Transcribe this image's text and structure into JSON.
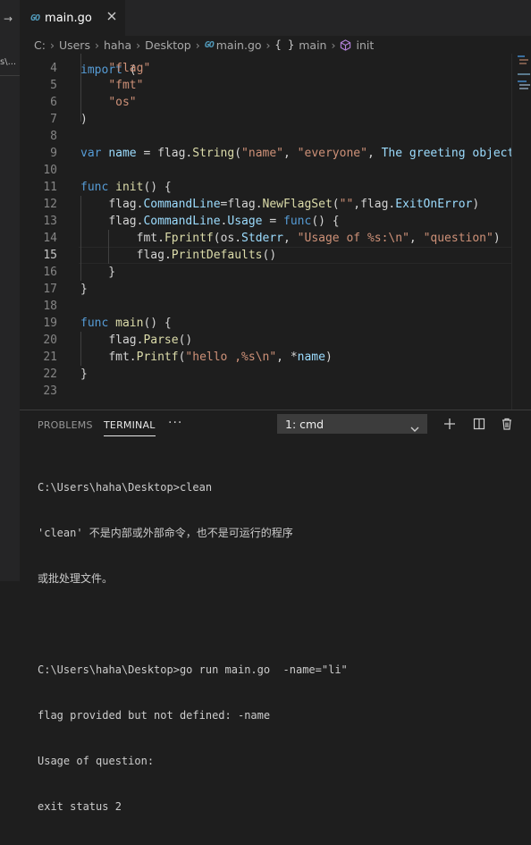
{
  "left_panel": {
    "top_glyph": "→",
    "cut_text": "s\\..."
  },
  "tab": {
    "icon": "go-file-icon",
    "icon_text": "GO",
    "label": "main.go",
    "close_icon": "close-icon"
  },
  "breadcrumb": {
    "items": [
      "C:",
      "Users",
      "haha",
      "Desktop"
    ],
    "file": "main.go",
    "braces": "{ }",
    "symbol1": "main",
    "symbol2": "init"
  },
  "editor": {
    "active_line": "15",
    "lines": [
      {
        "n": "4",
        "text": "    \"flag\""
      },
      {
        "n": "5",
        "text": "    \"fmt\""
      },
      {
        "n": "6",
        "text": "    \"os\""
      },
      {
        "n": "7",
        "text": ")"
      },
      {
        "n": "8",
        "text": ""
      },
      {
        "n": "9",
        "text": "var name = flag.String(\"name\", \"everyone\", \"The greeting object"
      },
      {
        "n": "10",
        "text": ""
      },
      {
        "n": "11",
        "text": "func init() {"
      },
      {
        "n": "12",
        "text": "    flag.CommandLine=flag.NewFlagSet(\"\",flag.ExitOnError)"
      },
      {
        "n": "13",
        "text": "    flag.CommandLine.Usage = func() {"
      },
      {
        "n": "14",
        "text": "        fmt.Fprintf(os.Stderr, \"Usage of %s:\\n\", \"question\")"
      },
      {
        "n": "15",
        "text": "        flag.PrintDefaults()"
      },
      {
        "n": "16",
        "text": "    }"
      },
      {
        "n": "17",
        "text": "}"
      },
      {
        "n": "18",
        "text": ""
      },
      {
        "n": "19",
        "text": "func main() {"
      },
      {
        "n": "20",
        "text": "    flag.Parse()"
      },
      {
        "n": "21",
        "text": "    fmt.Printf(\"hello ,%s\\n\", *name)"
      },
      {
        "n": "22",
        "text": "}"
      },
      {
        "n": "23",
        "text": ""
      }
    ]
  },
  "panel": {
    "tabs": [
      "PROBLEMS",
      "TERMINAL"
    ],
    "active_tab": "TERMINAL",
    "more": "···",
    "terminal_select": "1: cmd",
    "actions": [
      "add-icon",
      "split-icon",
      "trash-icon"
    ]
  },
  "terminal": {
    "lines": [
      "C:\\Users\\haha\\Desktop>clean",
      "'clean' 不是内部或外部命令，也不是可运行的程序",
      "或批处理文件。",
      "",
      "C:\\Users\\haha\\Desktop>go run main.go  -name=\"li\"",
      "flag provided but not defined: -name",
      "Usage of question:",
      "exit status 2"
    ]
  },
  "colors": {
    "editor_bg": "#1e1e1e",
    "keyword": "#569cd6",
    "function": "#dcdcaa",
    "string": "#ce9178",
    "identifier": "#9cdcfe",
    "go_icon": "#519aba"
  }
}
